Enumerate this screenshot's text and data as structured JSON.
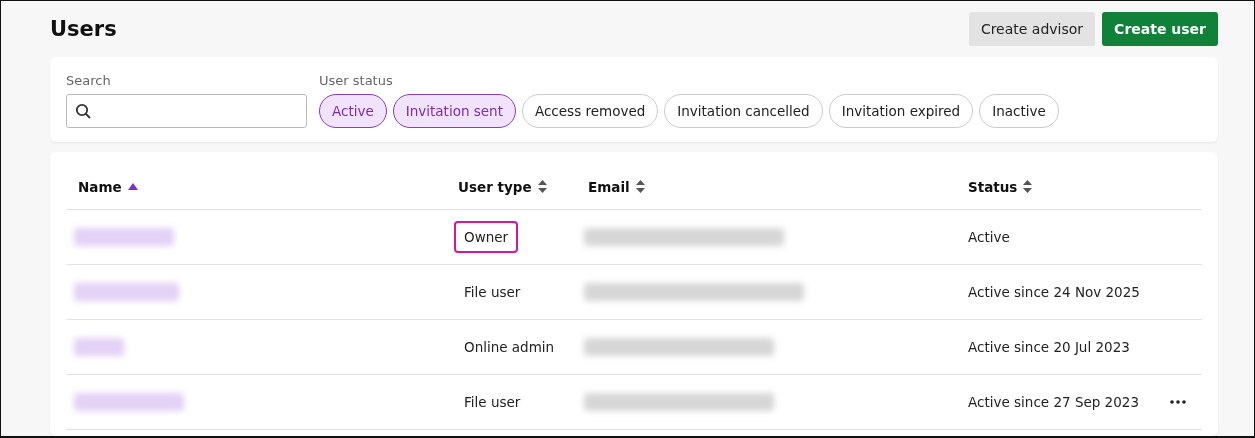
{
  "page": {
    "title": "Users"
  },
  "actions": [
    {
      "label": "Create advisor",
      "kind": "secondary"
    },
    {
      "label": "Create user",
      "kind": "primary"
    }
  ],
  "filters": {
    "search": {
      "label": "Search"
    },
    "status_label": "User status",
    "chips": [
      {
        "label": "Active",
        "selected": true
      },
      {
        "label": "Invitation sent",
        "selected": true
      },
      {
        "label": "Access removed",
        "selected": false
      },
      {
        "label": "Invitation cancelled",
        "selected": false
      },
      {
        "label": "Invitation expired",
        "selected": false
      },
      {
        "label": "Inactive",
        "selected": false
      }
    ]
  },
  "table": {
    "columns": [
      {
        "label": "Name",
        "sorted": true
      },
      {
        "label": "User type",
        "sorted": false
      },
      {
        "label": "Email",
        "sorted": false
      },
      {
        "label": "Status",
        "sorted": false
      }
    ],
    "rows": [
      {
        "user_type": "Owner",
        "highlighted": true,
        "status": "Active",
        "menu": false
      },
      {
        "user_type": "File user",
        "highlighted": false,
        "status": "Active since 24 Nov 2025",
        "menu": false
      },
      {
        "user_type": "Online admin",
        "highlighted": false,
        "status": "Active since 20 Jul 2023",
        "menu": false
      },
      {
        "user_type": "File user",
        "highlighted": false,
        "status": "Active since 27 Sep 2023",
        "menu": true
      }
    ]
  }
}
